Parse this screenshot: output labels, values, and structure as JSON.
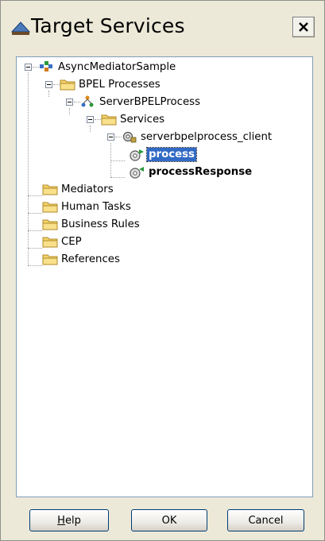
{
  "dialog": {
    "title": "Target Services"
  },
  "tree": {
    "root": "AsyncMediatorSample",
    "bpel_processes": "BPEL Processes",
    "server_process": "ServerBPELProcess",
    "services": "Services",
    "client": "serverbpelprocess_client",
    "process": "process",
    "process_response": "processResponse",
    "mediators": "Mediators",
    "human_tasks": "Human Tasks",
    "business_rules": "Business Rules",
    "cep": "CEP",
    "references": "References"
  },
  "buttons": {
    "help_mnemonic": "H",
    "help_rest": "elp",
    "ok": "OK",
    "cancel": "Cancel"
  },
  "icons": {
    "title": "dialog-arrow-icon",
    "composite": "composite-icon",
    "folder": "folder-icon",
    "bpel": "bpel-process-icon",
    "service": "service-gear-icon",
    "operation": "operation-gear-icon"
  }
}
